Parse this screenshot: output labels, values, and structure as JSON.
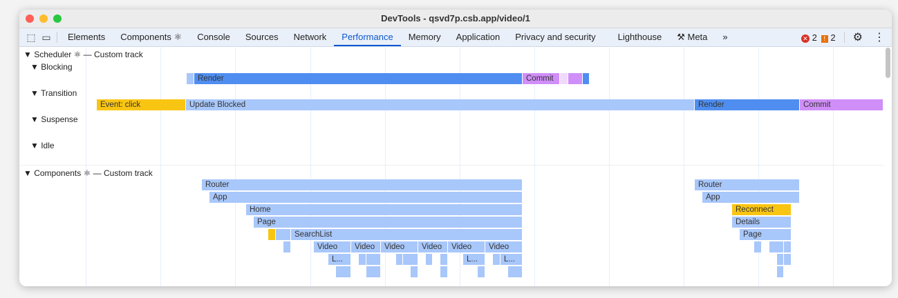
{
  "window": {
    "title": "DevTools - qsvd7p.csb.app/video/1"
  },
  "toolbar": {
    "inspect_icon": "inspect-element-icon",
    "device_icon": "device-toolbar-icon"
  },
  "tabs": [
    {
      "label": "Elements"
    },
    {
      "label": "Components ⚛"
    },
    {
      "label": "Console"
    },
    {
      "label": "Sources"
    },
    {
      "label": "Network"
    },
    {
      "label": "Performance",
      "active": true
    },
    {
      "label": "Memory"
    },
    {
      "label": "Application"
    },
    {
      "label": "Privacy and security"
    },
    {
      "label": "Lighthouse"
    },
    {
      "label": "⚒ Meta"
    }
  ],
  "more_tabs": "»",
  "status": {
    "errors": "2",
    "warnings": "2",
    "error_color": "#d93025",
    "warning_color": "#e8710a"
  },
  "tracks": {
    "scheduler": "Scheduler ⚛ — Custom track",
    "blocking": "Blocking",
    "transition": "Transition",
    "suspense": "Suspense",
    "idle": "Idle",
    "components": "Components ⚛ — Custom track"
  },
  "labels": {
    "render": "Render",
    "commit": "Commit",
    "event_click": "Event: click",
    "update_blocked": "Update Blocked",
    "router": "Router",
    "app": "App",
    "home": "Home",
    "page": "Page",
    "searchlist": "SearchList",
    "video": "Video",
    "l_trunc": "L...",
    "reconnect": "Reconnect",
    "details": "Details"
  },
  "colors": {
    "render": "#4f8ef0",
    "light": "#a8c7fa",
    "commit": "#d08ef8",
    "commit_light": "#efd9fc",
    "event": "#f9c513"
  }
}
